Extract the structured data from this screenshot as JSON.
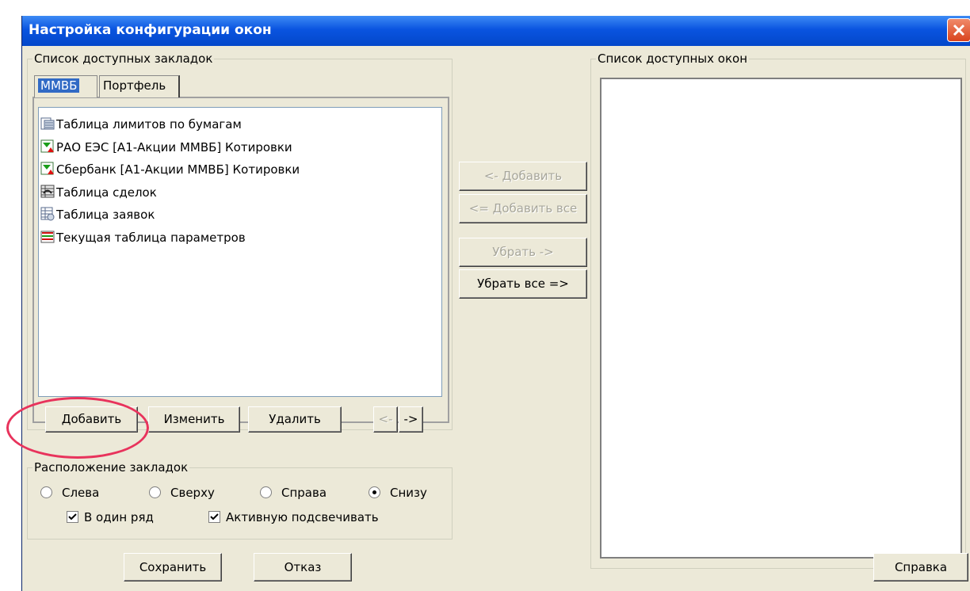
{
  "window": {
    "title": "Настройка конфигурации окон"
  },
  "tabs_group": {
    "legend": "Список доступных закладок",
    "tabs": [
      {
        "label": "ММВБ",
        "active": true
      },
      {
        "label": "Портфель",
        "active": false
      }
    ],
    "items": [
      {
        "label": "Таблица лимитов по бумагам",
        "icon": "limits-table-icon"
      },
      {
        "label": "РАО ЕЭС [А1-Акции ММВБ] Котировки",
        "icon": "quotes-icon"
      },
      {
        "label": "Сбербанк [А1-Акции ММВБ] Котировки",
        "icon": "quotes-icon"
      },
      {
        "label": "Таблица сделок",
        "icon": "trades-table-icon"
      },
      {
        "label": "Таблица заявок",
        "icon": "orders-table-icon"
      },
      {
        "label": "Текущая таблица параметров",
        "icon": "params-table-icon"
      }
    ],
    "add": "Добавить",
    "edit": "Изменить",
    "delete": "Удалить",
    "prev": "<-",
    "next": "->"
  },
  "middle": {
    "add": "<- Добавить",
    "add_all": "<= Добавить все",
    "remove": "Убрать ->",
    "remove_all": "Убрать все =>"
  },
  "placement": {
    "legend": "Расположение закладок",
    "options": [
      {
        "label": "Слева",
        "selected": false
      },
      {
        "label": "Сверху",
        "selected": false
      },
      {
        "label": "Справа",
        "selected": false
      },
      {
        "label": "Снизу",
        "selected": true
      }
    ],
    "one_row": {
      "label": "В один ряд",
      "checked": true
    },
    "highlight_active": {
      "label": "Активную подсвечивать",
      "checked": true
    }
  },
  "windows_group": {
    "legend": "Список доступных окон"
  },
  "footer": {
    "save": "Сохранить",
    "cancel": "Отказ",
    "help": "Справка"
  },
  "colors": {
    "title_bar": "#0a54e0",
    "selection": "#316ac5",
    "annotation": "#e8335c"
  }
}
